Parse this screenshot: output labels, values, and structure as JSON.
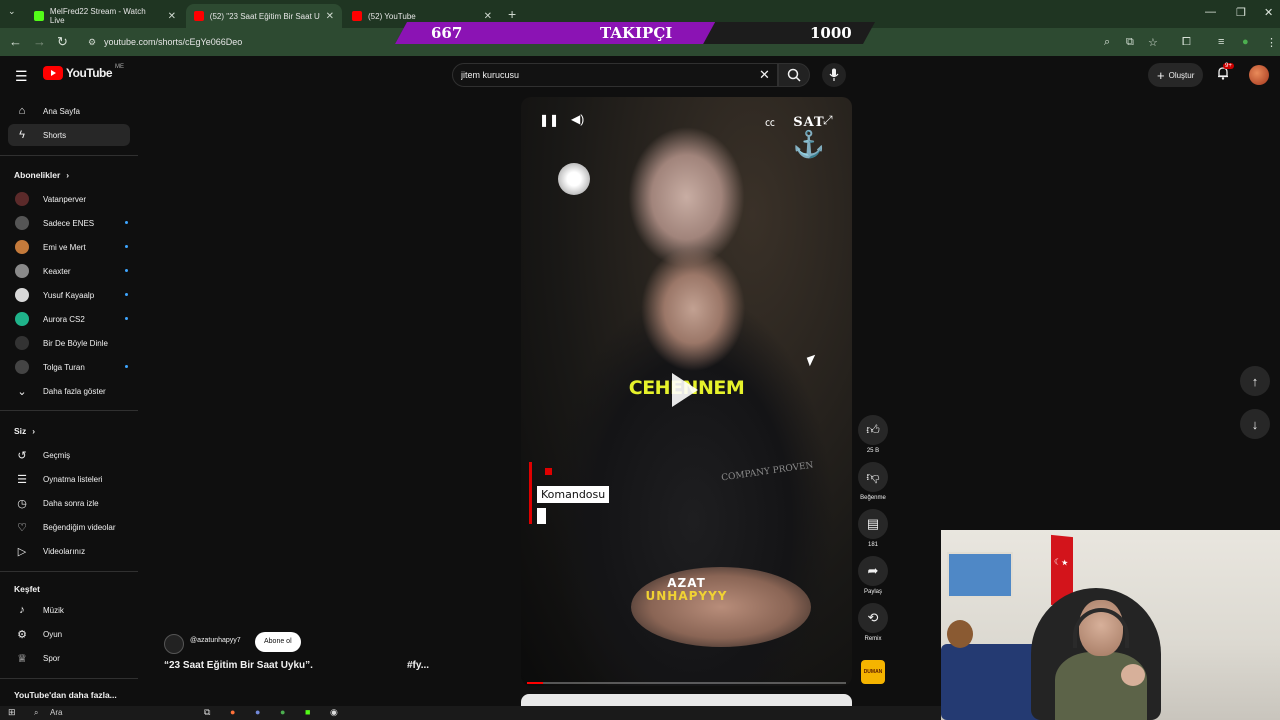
{
  "browser": {
    "tabs": [
      {
        "title": "MelFred22 Stream - Watch Live",
        "favicon_color": "#53fc18"
      },
      {
        "title": "(52) \"23 Saat Eğitim Bir Saat Uy",
        "favicon_color": "#ff0000"
      },
      {
        "title": "(52) YouTube",
        "favicon_color": "#ff0000"
      }
    ],
    "url": "youtube.com/shorts/cEgYe066Deo"
  },
  "overlay": {
    "current": "667",
    "label": "TAKIPÇI",
    "goal": "1000",
    "progress": 0.667,
    "fill_color": "#8b13b4"
  },
  "header": {
    "logo_text": "YouTube",
    "country": "ME",
    "search_value": "jitem kurucusu",
    "create_label": "Oluştur",
    "notification_count": "9+"
  },
  "sidebar": {
    "home": "Ana Sayfa",
    "shorts": "Shorts",
    "subscriptions_title": "Abonelikler",
    "subscriptions": [
      {
        "name": "Vatanperver",
        "live": false,
        "color": "#5b2a2a"
      },
      {
        "name": "Sadece ENES",
        "live": true,
        "color": "#555555"
      },
      {
        "name": "Emi ve Mert",
        "live": true,
        "color": "#c47a3b"
      },
      {
        "name": "Keaxter",
        "live": true,
        "color": "#8a8a8a"
      },
      {
        "name": "Yusuf Kayaalp",
        "live": true,
        "color": "#d8d8d8"
      },
      {
        "name": "Aurora CS2",
        "live": true,
        "color": "#1fb38a"
      },
      {
        "name": "Bir De Böyle Dinle",
        "live": false,
        "color": "#333333"
      },
      {
        "name": "Tolga Turan",
        "live": true,
        "color": "#444444"
      }
    ],
    "show_more": "Daha fazla göster",
    "you_title": "Siz",
    "you_items": [
      "Geçmiş",
      "Oynatma listeleri",
      "Daha sonra izle",
      "Beğendiğim videolar",
      "Videolarınız"
    ],
    "explore_title": "Keşfet",
    "explore_items": [
      "Müzik",
      "Oyun",
      "Spor"
    ],
    "more_from_youtube": "YouTube'dan daha fazla..."
  },
  "short": {
    "channel": "@azatunhapyy7",
    "subscribe_label": "Abone ol",
    "title": "“23 Saat Eğitim Bir Saat Uyku”.",
    "hashtag": "#fy...",
    "caption_top": "CEHENNEM",
    "caption_tag": "Komandosu",
    "watermark_top": "AZAT",
    "watermark_bottom": "UNHAPYYY",
    "emblem_text": "SAT",
    "shirt_text": "COMPANY PROVEN",
    "progress": 0.05,
    "actions": {
      "likes": "25 B",
      "dislike_label": "Beğenme",
      "comments": "181",
      "share_label": "Paylaş",
      "remix_label": "Remix",
      "album_label": "DUMAN"
    }
  },
  "taskbar": {
    "search_placeholder": "Ara"
  }
}
